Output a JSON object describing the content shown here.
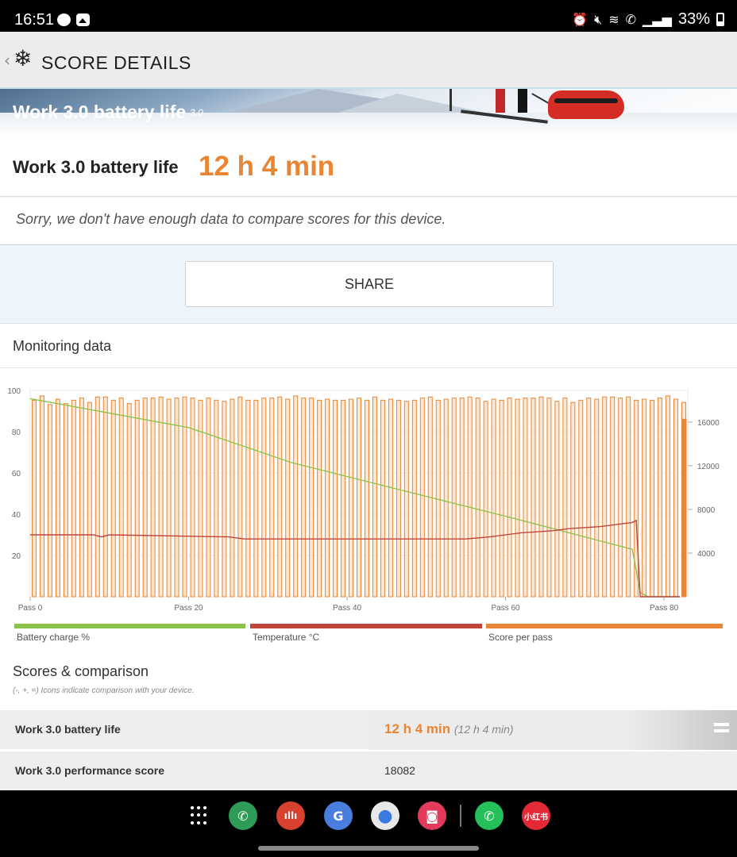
{
  "status_bar": {
    "time": "16:51",
    "battery_percent": "33%",
    "battery_level": 0.33,
    "icons": [
      "weibo-icon",
      "gallery-icon",
      "alarm-icon",
      "mute-icon",
      "wifi-icon",
      "wifi-calling-icon",
      "signal-icon",
      "battery-icon"
    ]
  },
  "app_bar": {
    "title": "SCORE DETAILS",
    "back_glyph": "‹",
    "logo_glyph": "❄"
  },
  "banner": {
    "title": "Work 3.0 battery life",
    "version": "3.0"
  },
  "score": {
    "label": "Work 3.0 battery life",
    "value": "12 h 4 min"
  },
  "compare_message": "Sorry, we don't have enough data to compare scores for this device.",
  "share_label": "SHARE",
  "monitoring": {
    "title": "Monitoring data",
    "legend": [
      {
        "label": "Battery charge %",
        "color": "#8bc34a"
      },
      {
        "label": "Temperature °C",
        "color": "#c0443c"
      },
      {
        "label": "Score per pass",
        "color": "#e98533"
      }
    ]
  },
  "chart_data": {
    "type": "bar",
    "title": "",
    "xlabel": "",
    "ylabel": "",
    "x_ticks": [
      "Pass 0",
      "Pass 20",
      "Pass 40",
      "Pass 60",
      "Pass 80"
    ],
    "y_left_ticks": [
      20,
      40,
      60,
      80,
      100
    ],
    "y_right_ticks": [
      4000,
      8000,
      12000,
      16000
    ],
    "ylim_left": [
      0,
      100
    ],
    "ylim_right": [
      0,
      18900
    ],
    "grid": true,
    "passes": 83,
    "series": [
      {
        "name": "Score per pass",
        "axis": "right",
        "color": "#e98533",
        "values": [
          18000,
          18400,
          17600,
          18100,
          17700,
          18000,
          18200,
          17800,
          18300,
          18300,
          18000,
          18200,
          17700,
          18000,
          18200,
          18200,
          18300,
          18100,
          18200,
          18300,
          18200,
          18000,
          18200,
          18000,
          17900,
          18100,
          18300,
          18000,
          18000,
          18200,
          18200,
          18300,
          18100,
          18400,
          18200,
          18200,
          18000,
          18100,
          18000,
          18000,
          18100,
          18200,
          18000,
          18300,
          18000,
          18100,
          18000,
          17900,
          18000,
          18200,
          18300,
          18000,
          18100,
          18200,
          18200,
          18300,
          18200,
          17900,
          18100,
          18000,
          18200,
          18100,
          18200,
          18200,
          18300,
          18200,
          17900,
          18200,
          17800,
          18000,
          18200,
          18100,
          18300,
          18300,
          18200,
          18300,
          18000,
          18100,
          18000,
          18200,
          18400,
          18100,
          17800,
          18000
        ],
        "tail_value": 16300
      },
      {
        "name": "Battery charge %",
        "axis": "left",
        "color": "#8bc34a",
        "x": [
          0,
          20,
          33,
          60,
          76,
          77,
          78,
          82
        ],
        "values": [
          96,
          82,
          65,
          39,
          23,
          2,
          0,
          0
        ]
      },
      {
        "name": "Temperature °C",
        "axis": "left",
        "color": "#c0443c",
        "x": [
          0,
          8,
          9,
          10,
          25,
          27,
          55,
          58,
          62,
          66,
          68,
          72,
          76,
          76.5,
          77,
          82
        ],
        "values": [
          30,
          30,
          29,
          30,
          29,
          28,
          28,
          29,
          31,
          32,
          33,
          34,
          36,
          37,
          0,
          0
        ]
      }
    ]
  },
  "scores": {
    "title": "Scores & comparison",
    "note": "(-, +, =) Icons indicate comparison with your device.",
    "rows": [
      {
        "label": "Work 3.0 battery life",
        "value": "12 h 4 min",
        "sub": "(12 h 4 min)"
      },
      {
        "label": "Work 3.0 performance score",
        "value": "18082"
      }
    ]
  },
  "dock": [
    {
      "name": "app-drawer-icon",
      "glyph": ""
    },
    {
      "name": "phone-app-icon",
      "glyph": "✆",
      "color": "#2e9b57"
    },
    {
      "name": "voice-recorder-app-icon",
      "glyph": "ıllı",
      "color": "#d8402f"
    },
    {
      "name": "translate-app-icon",
      "glyph": "G",
      "color": "#4a7ede"
    },
    {
      "name": "chrome-app-icon",
      "glyph": "●",
      "color": "#e8e8e8"
    },
    {
      "name": "camera-app-icon",
      "glyph": "◙",
      "color": "#e23b5b"
    },
    {
      "name": "whatsapp-app-icon",
      "glyph": "✆",
      "color": "#25c05b"
    },
    {
      "name": "xiaohongshu-app-icon",
      "glyph": "小红书",
      "color": "#e52a37"
    }
  ]
}
